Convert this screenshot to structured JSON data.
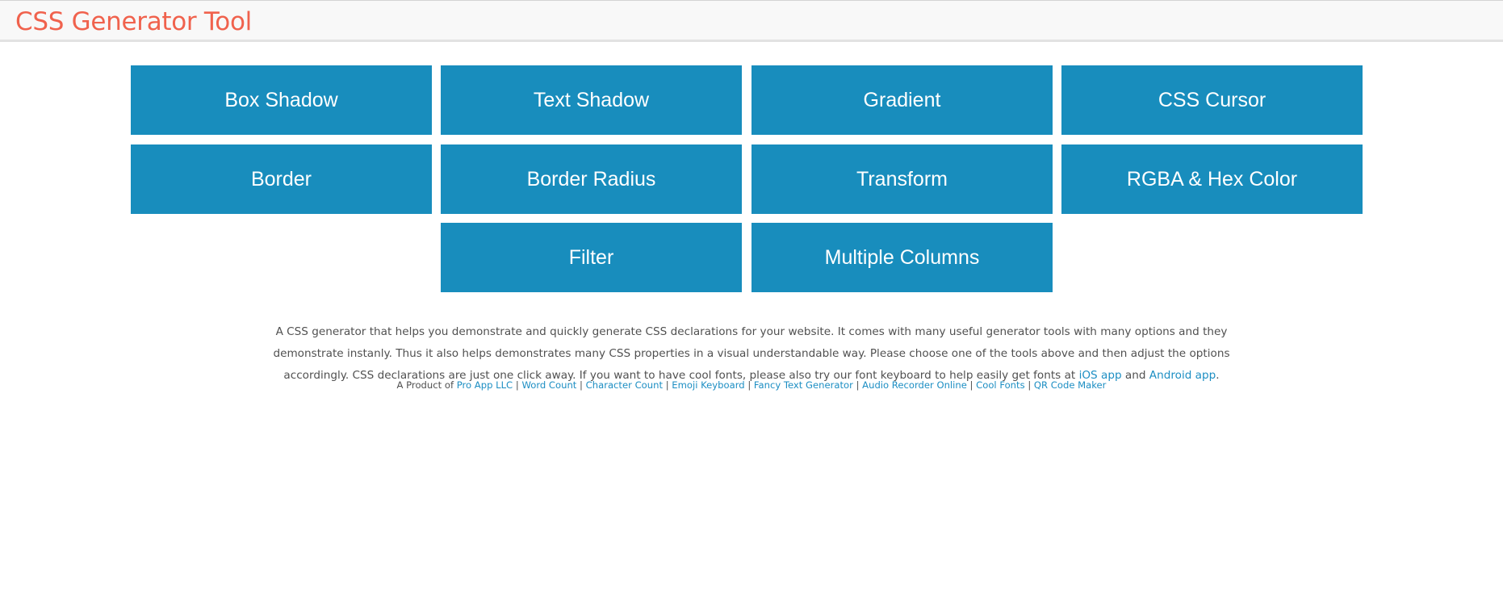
{
  "header": {
    "title": "CSS Generator Tool",
    "title_color": "#f0624d"
  },
  "tools": [
    {
      "label": "Box Shadow"
    },
    {
      "label": "Text Shadow"
    },
    {
      "label": "Gradient"
    },
    {
      "label": "CSS Cursor"
    },
    {
      "label": "Border"
    },
    {
      "label": "Border Radius"
    },
    {
      "label": "Transform"
    },
    {
      "label": "RGBA & Hex Color"
    },
    {
      "label": "Filter"
    },
    {
      "label": "Multiple Columns"
    }
  ],
  "tool_button_color": "#188dbd",
  "description": {
    "text_before": "A CSS generator that helps you demonstrate and quickly generate CSS declarations for your website. It comes with many useful generator tools with many options and they demonstrate instanly. Thus it also helps demonstrates many CSS properties in a visual understandable way. Please choose one of the tools above and then adjust the options accordingly. CSS declarations are just one click away. If you want to have cool fonts, please also try our font keyboard to help easily get fonts at ",
    "ios_link": "iOS app",
    "and_text": " and ",
    "android_link": "Android app",
    "end_text": "."
  },
  "footer": {
    "prefix": "A Product of ",
    "separator": "|",
    "links": [
      "Pro App LLC",
      "Word Count",
      "Character Count",
      "Emoji Keyboard",
      "Fancy Text Generator",
      "Audio Recorder Online",
      "Cool Fonts",
      "QR Code Maker"
    ]
  }
}
